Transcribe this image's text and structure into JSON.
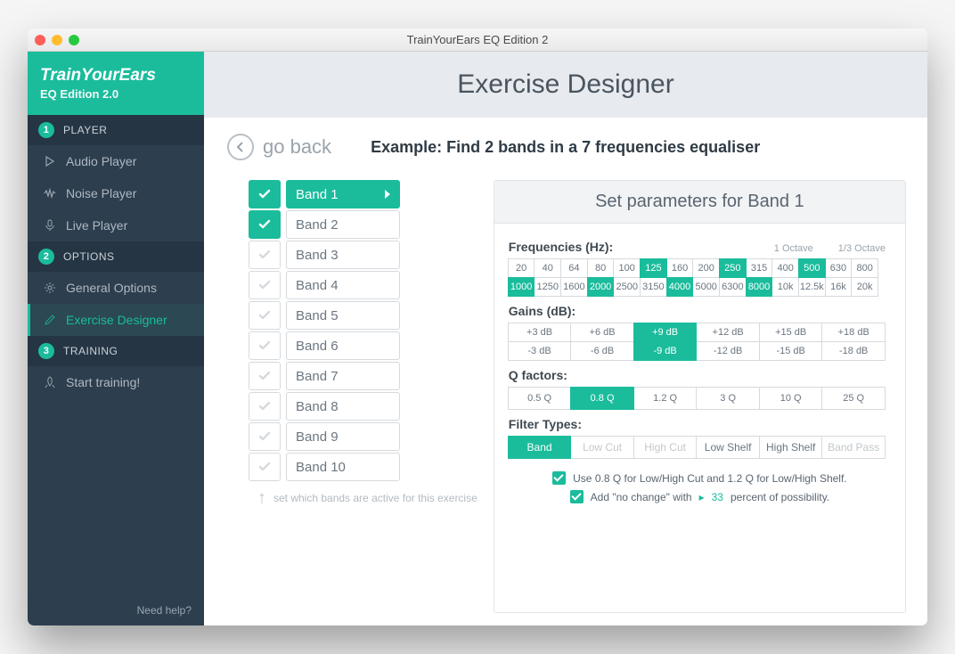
{
  "window_title": "TrainYourEars EQ Edition 2",
  "brand": {
    "title": "TrainYourEars",
    "subtitle": "EQ Edition 2.0"
  },
  "sidebar": {
    "sections": [
      {
        "num": "1",
        "label": "PLAYER"
      },
      {
        "num": "2",
        "label": "OPTIONS"
      },
      {
        "num": "3",
        "label": "TRAINING"
      }
    ],
    "items": {
      "audio_player": "Audio Player",
      "noise_player": "Noise Player",
      "live_player": "Live Player",
      "general_options": "General Options",
      "exercise_designer": "Exercise Designer",
      "start_training": "Start training!"
    },
    "help": "Need help?"
  },
  "page": {
    "title": "Exercise Designer",
    "go_back": "go back",
    "exercise_name": "Example: Find 2 bands in a 7 frequencies equaliser",
    "hint": "set which bands are active for this exercise"
  },
  "bands": [
    {
      "label": "Band 1",
      "active": true,
      "selected": true
    },
    {
      "label": "Band 2",
      "active": true,
      "selected": false
    },
    {
      "label": "Band 3",
      "active": false,
      "selected": false
    },
    {
      "label": "Band 4",
      "active": false,
      "selected": false
    },
    {
      "label": "Band 5",
      "active": false,
      "selected": false
    },
    {
      "label": "Band 6",
      "active": false,
      "selected": false
    },
    {
      "label": "Band 7",
      "active": false,
      "selected": false
    },
    {
      "label": "Band 8",
      "active": false,
      "selected": false
    },
    {
      "label": "Band 9",
      "active": false,
      "selected": false
    },
    {
      "label": "Band 10",
      "active": false,
      "selected": false
    }
  ],
  "panel": {
    "title": "Set parameters for Band 1",
    "freq_label": "Frequencies (Hz):",
    "octave1": "1 Octave",
    "octave13": "1/3 Octave",
    "frequencies": [
      {
        "v": "20"
      },
      {
        "v": "40"
      },
      {
        "v": "64"
      },
      {
        "v": "80"
      },
      {
        "v": "100"
      },
      {
        "v": "125",
        "on": true
      },
      {
        "v": "160"
      },
      {
        "v": "200"
      },
      {
        "v": "250",
        "on": true
      },
      {
        "v": "315"
      },
      {
        "v": "400"
      },
      {
        "v": "500",
        "on": true
      },
      {
        "v": "630"
      },
      {
        "v": "800"
      },
      {
        "v": "1000",
        "on": true
      },
      {
        "v": "1250"
      },
      {
        "v": "1600"
      },
      {
        "v": "2000",
        "on": true
      },
      {
        "v": "2500"
      },
      {
        "v": "3150"
      },
      {
        "v": "4000",
        "on": true
      },
      {
        "v": "5000"
      },
      {
        "v": "6300"
      },
      {
        "v": "8000",
        "on": true
      },
      {
        "v": "10k"
      },
      {
        "v": "12.5k"
      },
      {
        "v": "16k"
      },
      {
        "v": "20k"
      }
    ],
    "gain_label": "Gains (dB):",
    "gains_pos": [
      {
        "v": "+3 dB"
      },
      {
        "v": "+6 dB"
      },
      {
        "v": "+9 dB",
        "on": true
      },
      {
        "v": "+12 dB"
      },
      {
        "v": "+15 dB"
      },
      {
        "v": "+18 dB"
      }
    ],
    "gains_neg": [
      {
        "v": "-3 dB"
      },
      {
        "v": "-6 dB"
      },
      {
        "v": "-9 dB",
        "on": true
      },
      {
        "v": "-12 dB"
      },
      {
        "v": "-15 dB"
      },
      {
        "v": "-18 dB"
      }
    ],
    "q_label": "Q factors:",
    "q": [
      {
        "v": "0.5 Q"
      },
      {
        "v": "0.8 Q",
        "on": true
      },
      {
        "v": "1.2 Q"
      },
      {
        "v": "3 Q"
      },
      {
        "v": "10 Q"
      },
      {
        "v": "25 Q"
      }
    ],
    "ft_label": "Filter Types:",
    "ft": [
      {
        "v": "Band",
        "on": true
      },
      {
        "v": "Low Cut",
        "dim": true
      },
      {
        "v": "High Cut",
        "dim": true
      },
      {
        "v": "Low Shelf"
      },
      {
        "v": "High Shelf"
      },
      {
        "v": "Band Pass",
        "dim": true
      }
    ],
    "check1_pre": "Use 0.8 Q for Low/High Cut and 1.2 Q for Low/High Shelf.",
    "check2_pre": "Add \"no change\" with",
    "check2_pct": "33",
    "check2_post": "percent of possibility."
  }
}
